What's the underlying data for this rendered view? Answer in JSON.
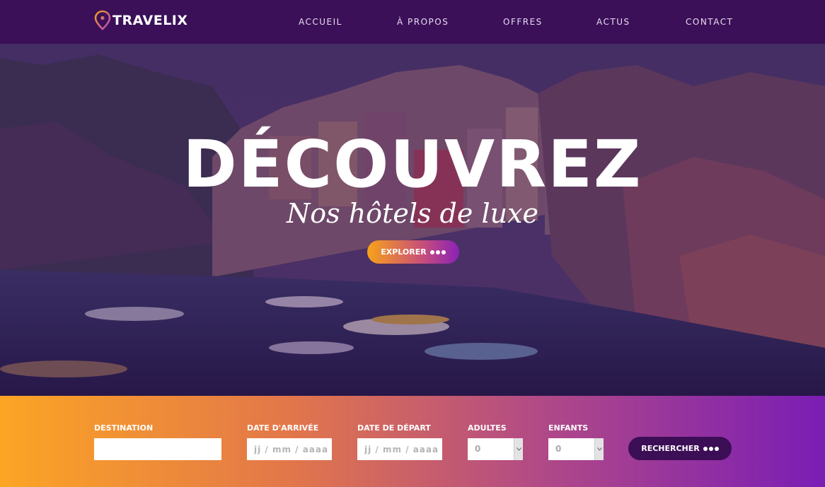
{
  "brand": {
    "name": "TRAVELIX"
  },
  "nav": {
    "items": [
      "ACCUEIL",
      "À PROPOS",
      "OFFRES",
      "ACTUS",
      "CONTACT"
    ]
  },
  "hero": {
    "title": "DÉCOUVREZ",
    "subtitle": "Nos hôtels de luxe",
    "cta_label": "EXPLORER"
  },
  "search": {
    "destination": {
      "label": "DESTINATION",
      "value": "",
      "placeholder": ""
    },
    "arrival": {
      "label": "DATE D'ARRIVÉE",
      "placeholder": "jj / mm / aaaa"
    },
    "departure": {
      "label": "DATE DE DÉPART",
      "placeholder": "jj / mm / aaaa"
    },
    "adults": {
      "label": "ADULTES",
      "value": "0"
    },
    "children": {
      "label": "ENFANTS",
      "value": "0"
    },
    "submit_label": "RECHERCHER"
  },
  "colors": {
    "nav_bg": "#3b1058",
    "accent_orange": "#fca524",
    "accent_purple": "#7a1db5",
    "button_dark": "#3c0e55"
  },
  "icons": {
    "logo": "map-pin-icon",
    "cta": "dots-icon",
    "select": "chevron-down-icon"
  }
}
